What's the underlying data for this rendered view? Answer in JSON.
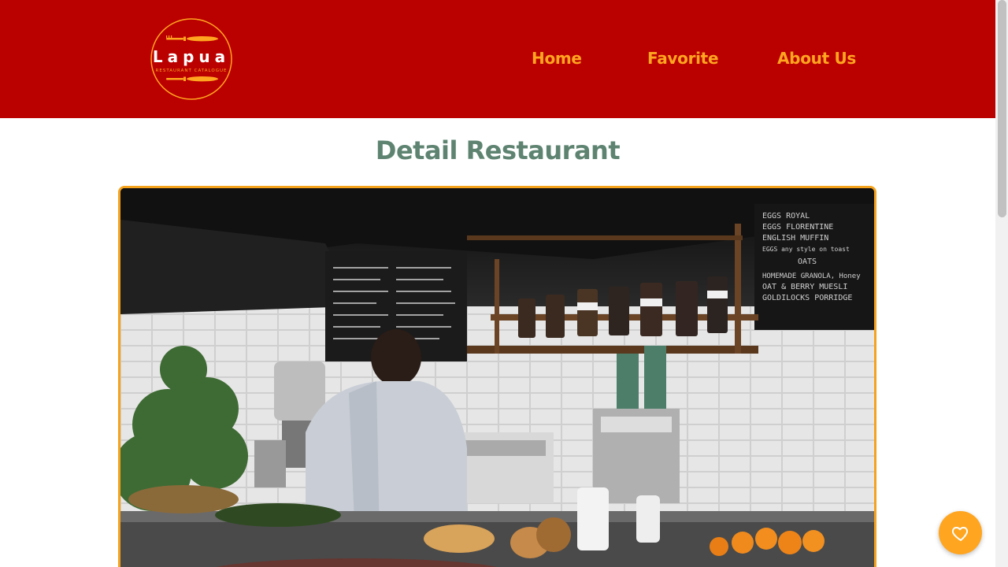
{
  "brand": {
    "name": "Lapua",
    "tagline": "RESTAURANT CATALOGUE"
  },
  "nav": {
    "items": [
      {
        "label": "Home"
      },
      {
        "label": "Favorite"
      },
      {
        "label": "About Us"
      }
    ]
  },
  "page": {
    "title": "Detail Restaurant"
  },
  "photo": {
    "subject": "restaurant kitchen counter with barista",
    "menu_board_lines": [
      "EGGS ROYAL",
      "EGGS FLORENTINE",
      "ENGLISH MUFFIN",
      "EGGS any style on toast",
      "OATS",
      "HOMEMADE GRANOLA, Honey",
      "OAT & BERRY MUESLI",
      "GOLDILOCKS PORRIDGE"
    ]
  },
  "fab": {
    "icon": "heart-icon"
  },
  "colors": {
    "header_bg": "#bb0000",
    "nav_text": "#ffa51f",
    "title_text": "#5e8471",
    "photo_border": "#f5a21c",
    "fab_bg": "#ffa51f"
  }
}
